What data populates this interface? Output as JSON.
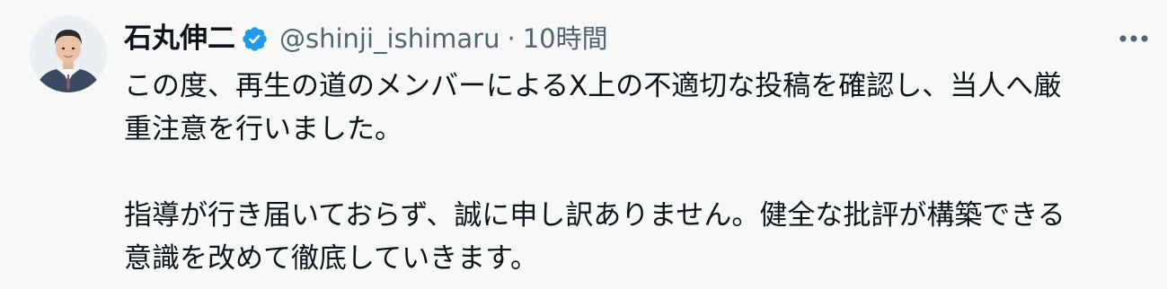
{
  "tweet": {
    "author": {
      "display_name": "石丸伸二",
      "handle": "@shinji_ishimaru",
      "verified": true
    },
    "separator": "·",
    "time": "10時間",
    "more_icon": "ellipsis-icon",
    "lines": [
      "この度、再生の道のメンバーによるX上の不適切な投稿を確認し、当人へ厳",
      "重注意を行いました。",
      "指導が行き届いておらず、誠に申し訳ありません。健全な批評が構築できる",
      "意識を改めて徹底していきます。"
    ]
  },
  "colors": {
    "background": "#f7f9f9",
    "text": "#0f1419",
    "secondary_text": "#536471",
    "verified_badge": "#1d9bf0"
  }
}
